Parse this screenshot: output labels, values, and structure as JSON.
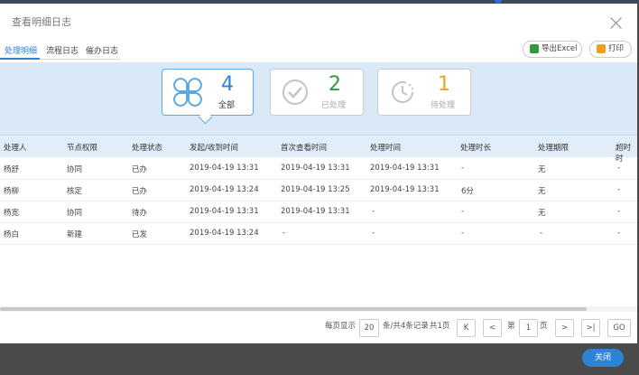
{
  "dialog": {
    "title": "查看明细日志"
  },
  "tabs": [
    {
      "label": "处理明细"
    },
    {
      "label": "流程日志"
    },
    {
      "label": "催办日志"
    }
  ],
  "toolbar": {
    "export_label": "导出Excel",
    "print_label": "打印"
  },
  "summary": [
    {
      "count": "4",
      "label": "全部",
      "color": "#2d83d6"
    },
    {
      "count": "2",
      "label": "已处理",
      "color": "#2f9a3a"
    },
    {
      "count": "1",
      "label": "待处理",
      "color": "#f0a020"
    }
  ],
  "table": {
    "headers": [
      "处理人",
      "节点权限",
      "处理状态",
      "发起/收到时间",
      "首次查看时间",
      "处理时间",
      "处理时长",
      "处理期限",
      "超时时"
    ],
    "rows": [
      [
        "杨舒",
        "协同",
        "已办",
        "2019-04-19 13:31",
        "2019-04-19 13:31",
        "2019-04-19 13:31",
        "-",
        "无",
        "-"
      ],
      [
        "杨柳",
        "核定",
        "已办",
        "2019-04-19 13:24",
        "2019-04-19 13:25",
        "2019-04-19 13:31",
        "6分",
        "无",
        "-"
      ],
      [
        "杨宽",
        "协同",
        "待办",
        "2019-04-19 13:31",
        "2019-04-19 13:31",
        "-",
        "-",
        "无",
        "-"
      ],
      [
        "杨白",
        "新建",
        "已发",
        "2019-04-19 13:24",
        "-",
        "-",
        "-",
        "-",
        "-"
      ]
    ]
  },
  "pagination": {
    "per_page_label": "每页显示",
    "per_page_value": "20",
    "records_label": "条/共4条记录",
    "pages_label": "共1页",
    "first": "K",
    "prev": "<",
    "page_prefix": "第",
    "page_value": "1",
    "page_suffix": "页",
    "next": ">",
    "last": ">|",
    "go": "GO"
  },
  "footer": {
    "close_label": "关闭"
  }
}
